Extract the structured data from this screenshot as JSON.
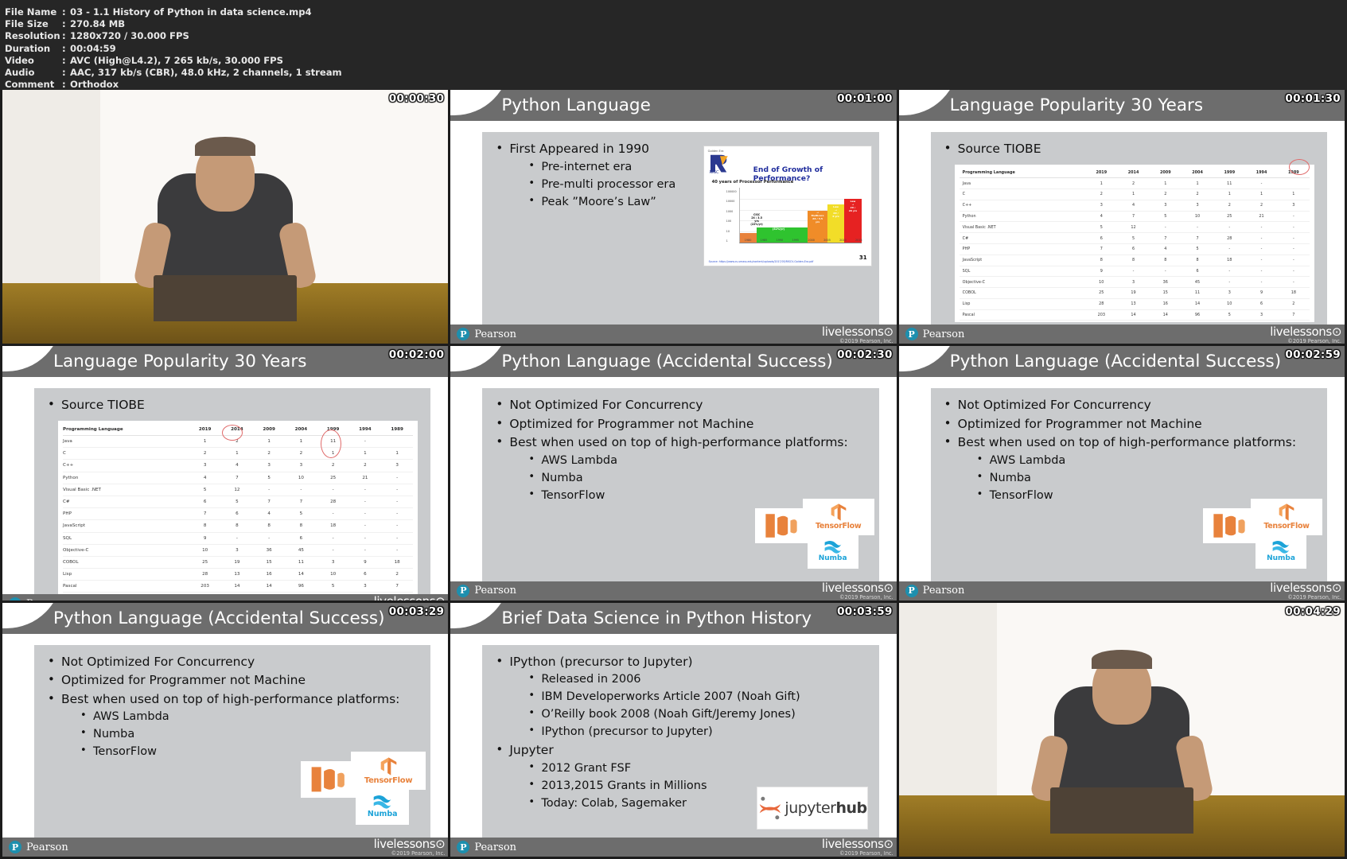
{
  "meta": {
    "rows": [
      {
        "key": "File Name",
        "value": "03 - 1.1 History of Python in data science.mp4"
      },
      {
        "key": "File Size",
        "value": "270.84 MB"
      },
      {
        "key": "Resolution",
        "value": "1280x720 / 30.000 FPS"
      },
      {
        "key": "Duration",
        "value": "00:04:59"
      },
      {
        "key": "Video",
        "value": "AVC (High@L4.2), 7 265 kb/s, 30.000 FPS"
      },
      {
        "key": "Audio",
        "value": "AAC, 317 kb/s (CBR), 48.0 kHz, 2 channels, 1 stream"
      },
      {
        "key": "Comment",
        "value": "Orthodox"
      }
    ],
    "separator": ":"
  },
  "footer": {
    "pearson_mark": "P",
    "pearson_word": "Pearson",
    "livelessons": "livelessons⊙",
    "copyright": "©2019 Pearson, Inc."
  },
  "thumbs": [
    {
      "id": "thumb-1",
      "kind": "video",
      "timestamp": "00:00:30"
    },
    {
      "id": "thumb-2",
      "kind": "slide",
      "timestamp": "00:01:00",
      "title": "Python Language",
      "bullets": [
        {
          "level": 1,
          "text": "First Appeared in 1990"
        },
        {
          "level": 2,
          "text": "Pre-internet era"
        },
        {
          "level": 2,
          "text": "Pre-multi processor era"
        },
        {
          "level": 2,
          "text": "Peak ”Moore’s Law”"
        }
      ],
      "figure": "moore-chart"
    },
    {
      "id": "thumb-3",
      "kind": "slide",
      "timestamp": "00:01:30",
      "title": "Language Popularity 30 Years",
      "bullets": [
        {
          "level": 1,
          "text": "Source TIOBE"
        }
      ],
      "figure": "tiobe-table",
      "annotations": 1
    },
    {
      "id": "thumb-4",
      "kind": "slide",
      "timestamp": "00:02:00",
      "title": "Language Popularity 30 Years",
      "bullets": [
        {
          "level": 1,
          "text": "Source TIOBE"
        }
      ],
      "figure": "tiobe-table-big",
      "annotations": 2
    },
    {
      "id": "thumb-5",
      "kind": "slide",
      "timestamp": "00:02:30",
      "title": "Python Language (Accidental Success)",
      "bullets": [
        {
          "level": 1,
          "text": "Not Optimized For Concurrency"
        },
        {
          "level": 1,
          "text": "Optimized for Programmer not Machine"
        },
        {
          "level": 1,
          "text": "Best when used on top of high-performance platforms:"
        },
        {
          "level": 2,
          "text": "AWS Lambda"
        },
        {
          "level": 2,
          "text": "Numba"
        },
        {
          "level": 2,
          "text": "TensorFlow"
        }
      ],
      "figure": "platform-logos"
    },
    {
      "id": "thumb-6",
      "kind": "slide",
      "timestamp": "00:02:59",
      "title": "Python Language (Accidental Success)",
      "bullets": [
        {
          "level": 1,
          "text": "Not Optimized For Concurrency"
        },
        {
          "level": 1,
          "text": "Optimized for Programmer not Machine"
        },
        {
          "level": 1,
          "text": "Best when used on top of high-performance platforms:"
        },
        {
          "level": 2,
          "text": "AWS Lambda"
        },
        {
          "level": 2,
          "text": "Numba"
        },
        {
          "level": 2,
          "text": "TensorFlow"
        }
      ],
      "figure": "platform-logos"
    },
    {
      "id": "thumb-7",
      "kind": "slide",
      "timestamp": "00:03:29",
      "title": "Python Language (Accidental Success)",
      "bullets": [
        {
          "level": 1,
          "text": "Not Optimized For Concurrency"
        },
        {
          "level": 1,
          "text": "Optimized for Programmer not Machine"
        },
        {
          "level": 1,
          "text": "Best when used on top of high-performance platforms:"
        },
        {
          "level": 2,
          "text": "AWS Lambda"
        },
        {
          "level": 2,
          "text": "Numba"
        },
        {
          "level": 2,
          "text": "TensorFlow"
        }
      ],
      "figure": "platform-logos"
    },
    {
      "id": "thumb-8",
      "kind": "slide",
      "timestamp": "00:03:59",
      "title": "Brief Data Science in Python History",
      "bullets": [
        {
          "level": 1,
          "text": "IPython (precursor to Jupyter)"
        },
        {
          "level": 2,
          "text": "Released in 2006"
        },
        {
          "level": 2,
          "text": "IBM Developerworks Article 2007 (Noah Gift)"
        },
        {
          "level": 2,
          "text": "O’Reilly book 2008 (Noah Gift/Jeremy Jones)"
        },
        {
          "level": 2,
          "text": "IPython (precursor to Jupyter)"
        },
        {
          "level": 1,
          "text": "Jupyter"
        },
        {
          "level": 2,
          "text": "2012 Grant FSF"
        },
        {
          "level": 2,
          "text": "2013,2015 Grants in Millions"
        },
        {
          "level": 2,
          "text": "Today: Colab, Sagemaker"
        }
      ],
      "figure": "jupyterhub-logo"
    },
    {
      "id": "thumb-9",
      "kind": "video",
      "timestamp": "00:04:29"
    }
  ],
  "tiobe": {
    "columns": [
      "Programming Language",
      "2019",
      "2014",
      "2009",
      "2004",
      "1999",
      "1994",
      "1989"
    ],
    "rows": [
      [
        "Java",
        "1",
        "2",
        "1",
        "1",
        "11",
        "-",
        ""
      ],
      [
        "C",
        "2",
        "1",
        "2",
        "2",
        "1",
        "1",
        "1"
      ],
      [
        "C++",
        "3",
        "4",
        "3",
        "3",
        "2",
        "2",
        "3"
      ],
      [
        "Python",
        "4",
        "7",
        "5",
        "10",
        "25",
        "21",
        "-"
      ],
      [
        "Visual Basic .NET",
        "5",
        "12",
        "-",
        "-",
        "-",
        "-",
        "-"
      ],
      [
        "C#",
        "6",
        "5",
        "7",
        "7",
        "28",
        "-",
        "-"
      ],
      [
        "PHP",
        "7",
        "6",
        "4",
        "5",
        "-",
        "-",
        "-"
      ],
      [
        "JavaScript",
        "8",
        "8",
        "8",
        "8",
        "18",
        "-",
        "-"
      ],
      [
        "SQL",
        "9",
        "-",
        "-",
        "6",
        "-",
        "-",
        "-"
      ],
      [
        "Objective-C",
        "10",
        "3",
        "36",
        "45",
        "-",
        "-",
        "-"
      ],
      [
        "COBOL",
        "25",
        "19",
        "15",
        "11",
        "3",
        "9",
        "18"
      ],
      [
        "Lisp",
        "28",
        "13",
        "16",
        "14",
        "10",
        "6",
        "2"
      ],
      [
        "Pascal",
        "203",
        "14",
        "14",
        "96",
        "5",
        "3",
        "7"
      ]
    ]
  },
  "moore_chart": {
    "type": "area",
    "corner_label": "Golden Era",
    "brand": "RISC-V",
    "title": "End of Growth of Performance?",
    "subtitle": "40 years of Processor Performance",
    "ylabel": "Performance vs. VAX11-780",
    "ytick_labels": [
      "1",
      "10",
      "100",
      "1000",
      "10000",
      "100000"
    ],
    "xtick_labels": [
      "1980",
      "1985",
      "1990",
      "1995",
      "2000",
      "2005",
      "2010",
      "2015"
    ],
    "page_number": "31",
    "source": "Source: https://www.cs.umass.edu/content/uploads/2017/05/RISCV-Golden-Era.pdf",
    "bands": [
      {
        "label": "CISC 2X / 3.5 yrs (22%/yr)",
        "color": "#e8823c",
        "x": 0,
        "w": 14
      },
      {
        "label": "RISC 2X / 1.5 yrs (52%/yr)",
        "color": "#2fc32f",
        "x": 14,
        "w": 42
      },
      {
        "label": "End of Dennard Scaling → Multicore 2X / 3.5 yrs (23%/yr)",
        "color": "#f08c28",
        "x": 56,
        "w": 16
      },
      {
        "label": "Amdahl’s Law → 2X / 6 yrs (12%/yr)",
        "color": "#f2dd28",
        "x": 72,
        "w": 14
      },
      {
        "label": "End of Moore’s Law → 2X / 20 yrs (3%/yr)",
        "color": "#e62222",
        "x": 86,
        "w": 14
      }
    ]
  },
  "logos": {
    "aws": "AWS Lambda",
    "tensorflow": "TensorFlow",
    "numba": "Numba",
    "jupyterhub_light": "jupyter",
    "jupyterhub_bold": "hub"
  },
  "colors": {
    "title_bar": "#6d6d6d",
    "body_panel": "#c9cbcd",
    "accent_teal": "#1d8fae",
    "annotation_red": "#e06a6a",
    "background": "#1c1c1c"
  }
}
